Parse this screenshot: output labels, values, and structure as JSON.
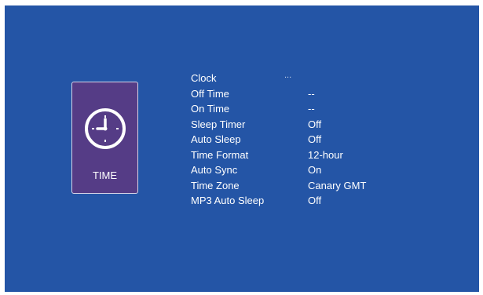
{
  "category": {
    "label": "TIME",
    "icon": "clock-icon"
  },
  "settings": [
    {
      "label": "Clock",
      "value": "..."
    },
    {
      "label": "Off Time",
      "value": "--"
    },
    {
      "label": "On Time",
      "value": "--"
    },
    {
      "label": "Sleep Timer",
      "value": "Off"
    },
    {
      "label": "Auto Sleep",
      "value": "Off"
    },
    {
      "label": "Time Format",
      "value": "12-hour"
    },
    {
      "label": "Auto Sync",
      "value": "On"
    },
    {
      "label": "Time Zone",
      "value": "Canary GMT"
    },
    {
      "label": "MP3 Auto Sleep",
      "value": "Off"
    }
  ],
  "colors": {
    "background": "#2455a6",
    "card": "#553c86",
    "text": "#ffffff"
  }
}
